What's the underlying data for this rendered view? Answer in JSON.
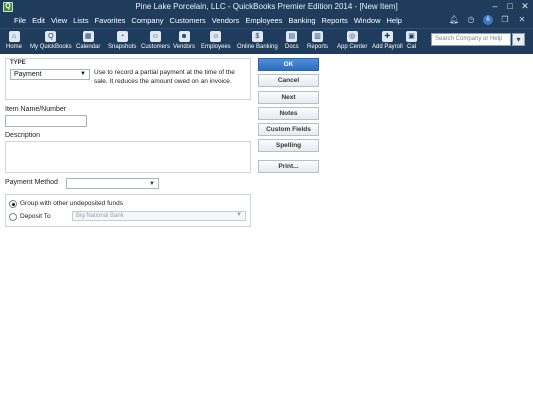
{
  "window": {
    "title": "Pine Lake Porcelain, LLC  - QuickBooks Premier Edition 2014 - [New Item]",
    "app_icon_glyph": "Q",
    "controls": [
      "–",
      "□",
      "✕"
    ]
  },
  "menu": {
    "items": [
      "File",
      "Edit",
      "View",
      "Lists",
      "Favorites",
      "Company",
      "Customers",
      "Vendors",
      "Employees",
      "Banking",
      "Reports",
      "Window",
      "Help"
    ],
    "badge_count": "6"
  },
  "toolbar": {
    "items": [
      {
        "label": "Home",
        "icon": "home-icon"
      },
      {
        "label": "My QuickBooks",
        "icon": "my-quickbooks-icon"
      },
      {
        "label": "Calendar",
        "icon": "calendar-icon"
      },
      {
        "label": "Snapshots",
        "icon": "snapshots-icon"
      },
      {
        "label": "Customers",
        "icon": "customers-icon"
      },
      {
        "label": "Vendors",
        "icon": "vendors-icon"
      },
      {
        "label": "Employees",
        "icon": "employees-icon"
      },
      {
        "label": "Online Banking",
        "icon": "online-banking-icon"
      },
      {
        "label": "Docs",
        "icon": "docs-icon"
      },
      {
        "label": "Reports",
        "icon": "reports-icon"
      },
      {
        "label": "App Center",
        "icon": "app-center-icon"
      },
      {
        "label": "Add Payroll",
        "icon": "add-payroll-icon"
      },
      {
        "label": "Cal",
        "icon": "cal-icon"
      }
    ],
    "search_placeholder": "Search Company or Help"
  },
  "form": {
    "type_label": "TYPE",
    "type_value": "Payment",
    "type_description": "Use to record a partial payment at the time of the sale. It reduces the amount owed on an invoice.",
    "item_name_label": "Item Name/Number",
    "item_name_value": "",
    "description_label": "Description",
    "description_value": "",
    "payment_method_label": "Payment Method",
    "payment_method_value": "",
    "group_label": "Group with other undeposited funds",
    "deposit_to_label": "Deposit To",
    "deposit_to_value": "Big National Bank"
  },
  "buttons": {
    "ok": "OK",
    "cancel": "Cancel",
    "next": "Next",
    "notes": "Notes",
    "custom_fields": "Custom Fields",
    "spelling": "Spelling",
    "print": "Print..."
  },
  "colors": {
    "chrome": "#1f3c5c",
    "primary_button": "#2d6fbf"
  }
}
